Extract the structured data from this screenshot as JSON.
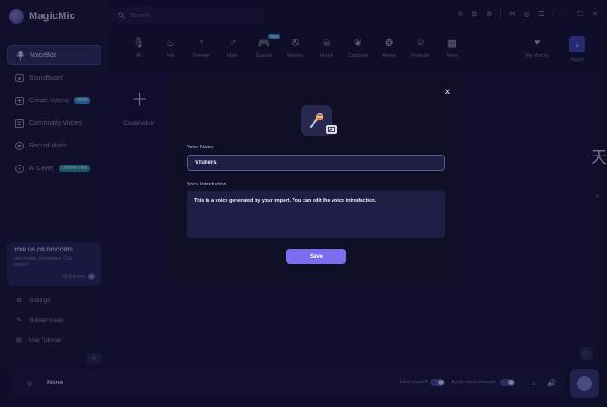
{
  "app": {
    "name": "MagicMic"
  },
  "search": {
    "placeholder": "Search..."
  },
  "sidebar": {
    "items": [
      {
        "label": "VoiceBox",
        "icon": "microphone-icon",
        "active": true
      },
      {
        "label": "Soundboard",
        "icon": "soundboard-icon"
      },
      {
        "label": "Create Voices",
        "icon": "create-voice-icon",
        "badge": "NEW"
      },
      {
        "label": "Community Voices",
        "icon": "community-icon"
      },
      {
        "label": "Record Mode",
        "icon": "record-icon"
      },
      {
        "label": "AI Cover",
        "icon": "ai-cover-icon",
        "badge": "Limited Free"
      }
    ],
    "discord": {
      "title": "JOIN US ON DISCORD!",
      "subtitle": "Use guides, Giveaways, Cool people!",
      "link": "Click to join"
    },
    "bottom_items": [
      {
        "label": "Settings",
        "icon": "settings-icon"
      },
      {
        "label": "Submit Ideas",
        "icon": "ideas-icon"
      },
      {
        "label": "Use Tutorial",
        "icon": "tutorial-icon"
      }
    ]
  },
  "categories": [
    {
      "label": "All",
      "icon": "mic-icon"
    },
    {
      "label": "Hot",
      "icon": "flame-icon"
    },
    {
      "label": "Female",
      "icon": "female-icon"
    },
    {
      "label": "Male",
      "icon": "male-icon"
    },
    {
      "label": "Games",
      "icon": "gamepad-icon",
      "tag": "New"
    },
    {
      "label": "Movies",
      "icon": "film-icon"
    },
    {
      "label": "Horror",
      "icon": "skull-icon"
    },
    {
      "label": "Cartoons",
      "icon": "bunny-icon"
    },
    {
      "label": "Anime",
      "icon": "bear-icon"
    },
    {
      "label": "Feature",
      "icon": "mask-icon"
    },
    {
      "label": "More",
      "icon": "grid-icon"
    }
  ],
  "categories_right": [
    {
      "label": "My Voices",
      "icon": "heart-icon"
    },
    {
      "label": "Import",
      "icon": "import-icon"
    }
  ],
  "main": {
    "create_label": "Create voice",
    "side_glyph": "天"
  },
  "modal": {
    "voice_name_label": "Voice Name",
    "voice_name_value": "VTubers",
    "intro_label": "Voice Introduction",
    "intro_value": "This is a voice generated by your import. You can edit the voice introduction.",
    "save_label": "Save"
  },
  "footer": {
    "current_voice": "None",
    "hear_myself": "Hear myself",
    "apply_changer": "Apply voice changer"
  },
  "colors": {
    "accent": "#7b6df0",
    "background": "#17173c",
    "modal": "#0f0f26"
  }
}
